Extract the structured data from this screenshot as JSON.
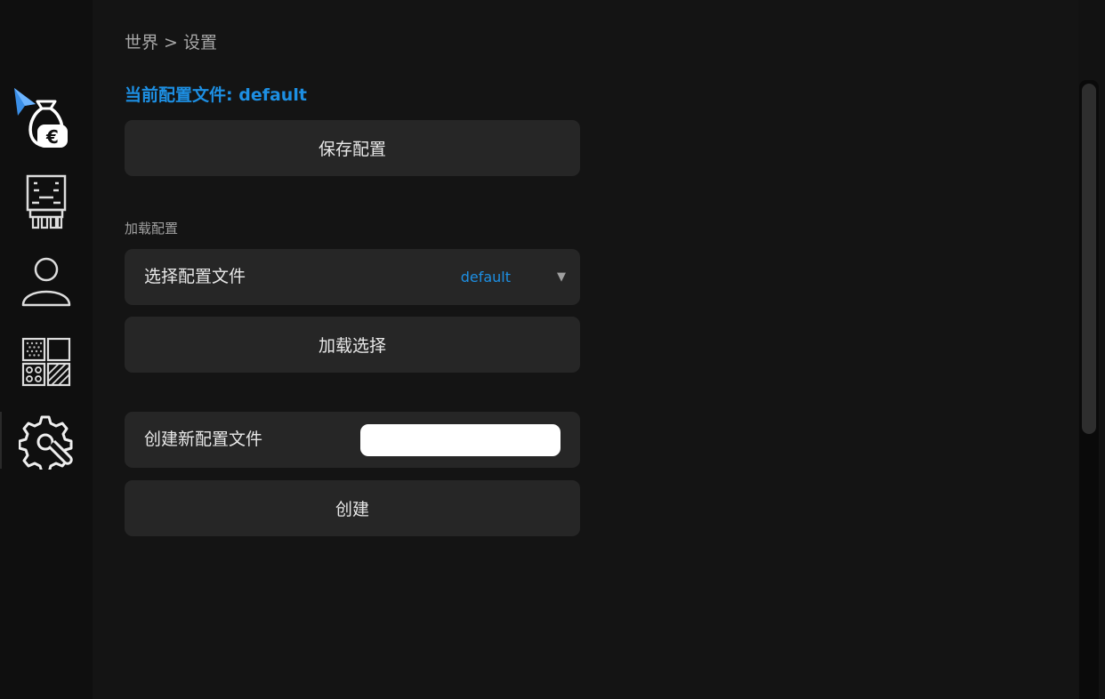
{
  "breadcrumb": "世界 > 设置",
  "current_profile": "当前配置文件: default",
  "save_button": "保存配置",
  "load_section_label": "加载配置",
  "select_row": {
    "label": "选择配置文件",
    "value": "default",
    "caret": "▼"
  },
  "load_button": "加载选择",
  "create_row": {
    "label": "创建新配置文件",
    "input_value": "",
    "input_placeholder": ""
  },
  "create_button": "创建",
  "sidebar": {
    "items": [
      {
        "icon": "money-bag-euro-icon"
      },
      {
        "icon": "robot-icon"
      },
      {
        "icon": "user-icon"
      },
      {
        "icon": "materials-grid-icon"
      },
      {
        "icon": "settings-gear-wrench-icon",
        "active": true
      }
    ]
  },
  "colors": {
    "accent": "#1d8fe3",
    "panel": "#262626",
    "background": "#141414"
  }
}
